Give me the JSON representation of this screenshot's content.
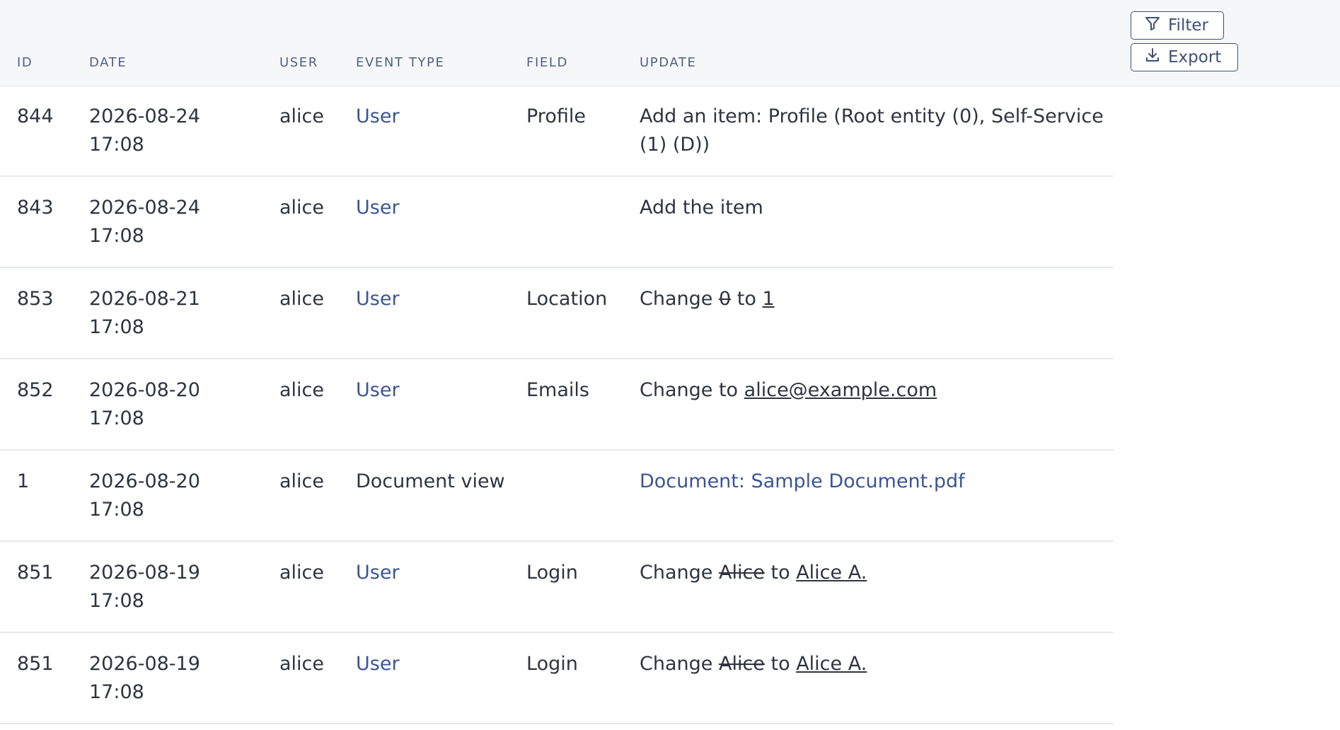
{
  "toolbar": {
    "filter_label": "Filter",
    "export_label": "Export",
    "filter_icon": "filter-icon",
    "export_icon": "download-icon"
  },
  "columns": {
    "id": "ID",
    "date": "DATE",
    "user": "USER",
    "event_type": "EVENT TYPE",
    "field": "FIELD",
    "update": "UPDATE"
  },
  "colors": {
    "link": "#3b5595",
    "header_text": "#4e6285",
    "text": "#2f3440",
    "header_bg": "#f6f7f9"
  },
  "rows": [
    {
      "id": "844",
      "date": "2026-08-24",
      "time": "17:08",
      "user": "alice",
      "event_type": "User",
      "event_type_link": true,
      "field": "Profile",
      "update_text": "Add an item: Profile (Root entity (0), Self-Service (1) (D))"
    },
    {
      "id": "843",
      "date": "2026-08-24",
      "time": "17:08",
      "user": "alice",
      "event_type": "User",
      "event_type_link": true,
      "field": "",
      "update_text": "Add the item"
    },
    {
      "id": "853",
      "date": "2026-08-21",
      "time": "17:08",
      "user": "alice",
      "event_type": "User",
      "event_type_link": true,
      "field": "Location",
      "update_prefix": "Change",
      "update_old": "0",
      "update_mid": "to",
      "update_new": "1"
    },
    {
      "id": "852",
      "date": "2026-08-20",
      "time": "17:08",
      "user": "alice",
      "event_type": "User",
      "event_type_link": true,
      "field": "Emails",
      "update_prefix": "Change",
      "update_mid": "to",
      "update_new": "alice@example.com"
    },
    {
      "id": "1",
      "date": "2026-08-20",
      "time": "17:08",
      "user": "alice",
      "event_type": "Document view",
      "event_type_link": false,
      "field": "",
      "update_link": "Document: Sample Document.pdf"
    },
    {
      "id": "851",
      "date": "2026-08-19",
      "time": "17:08",
      "user": "alice",
      "event_type": "User",
      "event_type_link": true,
      "field": "Login",
      "update_prefix": "Change",
      "update_old": "Alice",
      "update_mid": "to",
      "update_new": "Alice A."
    },
    {
      "id": "851",
      "date": "2026-08-19",
      "time": "17:08",
      "user": "alice",
      "event_type": "User",
      "event_type_link": true,
      "field": "Login",
      "update_prefix": "Change",
      "update_old": "Alice",
      "update_mid": "to",
      "update_new": "Alice A."
    }
  ]
}
